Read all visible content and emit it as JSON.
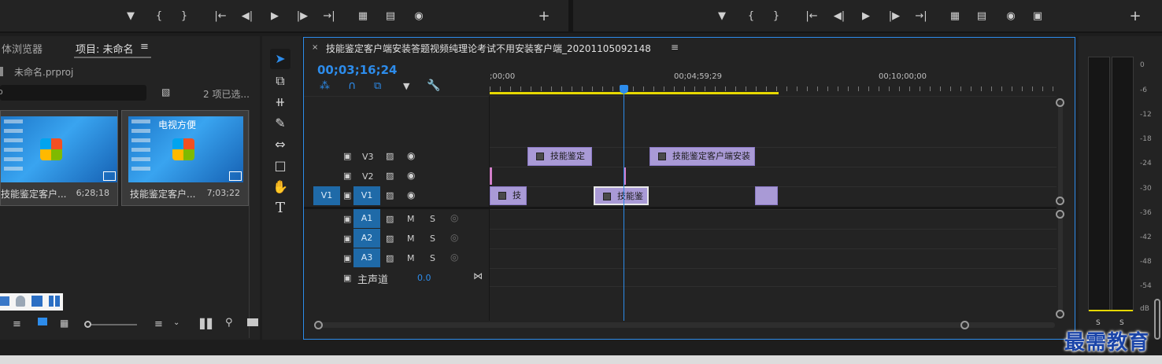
{
  "project_panel": {
    "tab_media_browser": "体浏览器",
    "tab_project": "项目: 未命名",
    "project_file": "未命名.prproj",
    "items_selected": "2 项已选...",
    "clips": [
      {
        "name": "技能鉴定客户...",
        "duration": "6;28;18"
      },
      {
        "name": "技能鉴定客户...",
        "duration": "7;03;22",
        "overlay_text": "电视方便"
      }
    ]
  },
  "timeline": {
    "sequence_name": "技能鉴定客户端安装答题视频纯理论考试不用安装客户端_20201105092148",
    "timecode": "00;03;16;24",
    "ruler_labels": [
      ";00;00",
      "00;04;59;29",
      "00;10;00;00"
    ],
    "video_tracks": [
      {
        "label": "V3"
      },
      {
        "label": "V2"
      },
      {
        "label": "V1",
        "source_target": "V1"
      }
    ],
    "audio_tracks": [
      {
        "label": "A1",
        "m": "M",
        "s": "S"
      },
      {
        "label": "A2",
        "m": "M",
        "s": "S"
      },
      {
        "label": "A3",
        "m": "M",
        "s": "S"
      }
    ],
    "master": {
      "label": "主声道",
      "value": "0.0"
    },
    "clips": {
      "v3_a": "技能鉴定",
      "v3_b": "技能鉴定客户端安装",
      "v1_a": "技",
      "v1_b": "技能鉴"
    }
  },
  "meters": {
    "scale": [
      "0",
      "-6",
      "-12",
      "-18",
      "-24",
      "-30",
      "-36",
      "-42",
      "-48",
      "-54",
      "dB"
    ],
    "solo_left": "S",
    "solo_right": "S"
  },
  "watermark": "最需教育",
  "colors": {
    "clip": "#a99ad6",
    "accent": "#2d8ceb",
    "target": "#1f6aa8",
    "work_area": "#e6d800"
  }
}
